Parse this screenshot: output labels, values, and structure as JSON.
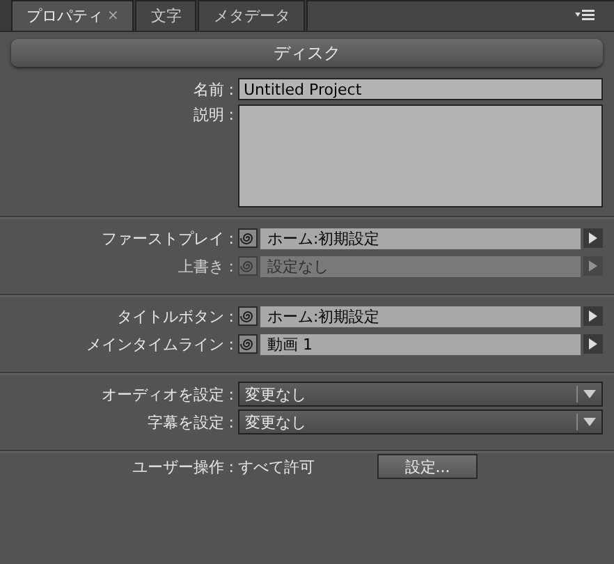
{
  "tabs": [
    {
      "label": "プロパティ",
      "selected": true,
      "close": "×"
    },
    {
      "label": "文字",
      "selected": false
    },
    {
      "label": "メタデータ",
      "selected": false
    }
  ],
  "header": "ディスク",
  "name_field": {
    "label": "名前 :",
    "value": "Untitled Project"
  },
  "description_field": {
    "label": "説明 :"
  },
  "groups": [
    [
      {
        "kind": "link",
        "label": "ファーストプレイ :",
        "value": "ホーム:初期設定",
        "disabled": false
      },
      {
        "kind": "link",
        "label": "上書き :",
        "value": "設定なし",
        "disabled": true
      }
    ],
    [
      {
        "kind": "link",
        "label": "タイトルボタン :",
        "value": "ホーム:初期設定",
        "disabled": false
      },
      {
        "kind": "link",
        "label": "メインタイムライン :",
        "value": "動画 1",
        "disabled": false
      }
    ],
    [
      {
        "kind": "dropdown",
        "label": "オーディオを設定 :",
        "value": "変更なし"
      },
      {
        "kind": "dropdown",
        "label": "字幕を設定 :",
        "value": "変更なし"
      }
    ]
  ],
  "user_ops": {
    "label": "ユーザー操作 :",
    "value": "すべて許可",
    "button": "設定..."
  }
}
